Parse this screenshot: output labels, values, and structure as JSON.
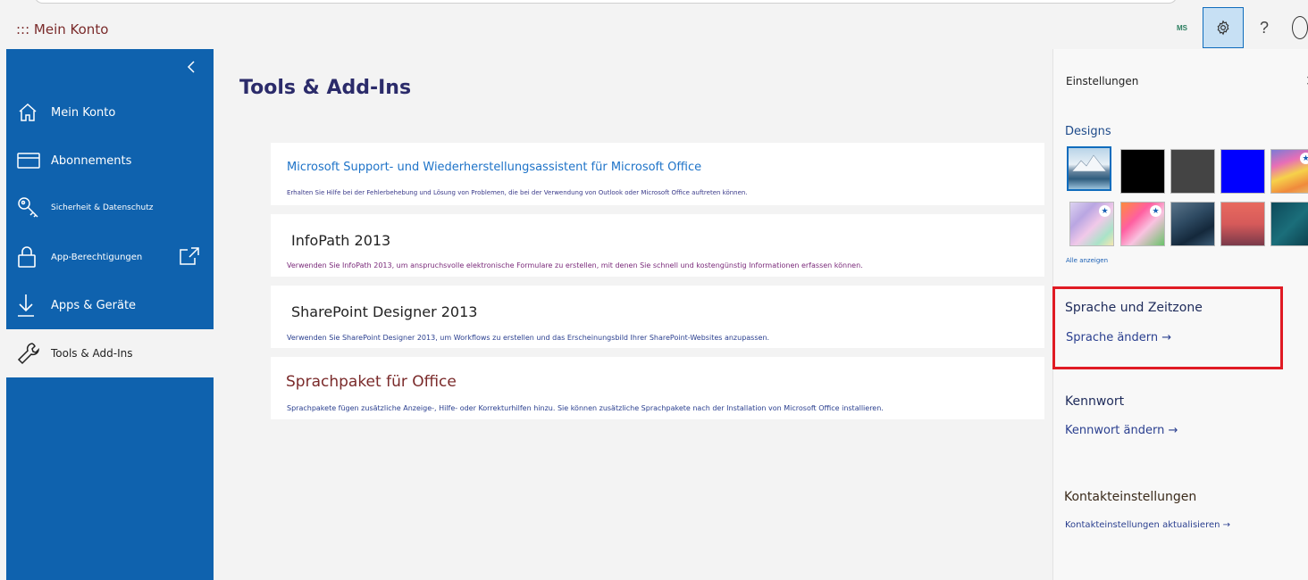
{
  "app": {
    "title": "::: Mein Konto"
  },
  "topbar": {
    "ms_badge": "MS",
    "help": "?"
  },
  "sidebar": {
    "items": [
      {
        "label": "Mein Konto",
        "icon": "home-icon"
      },
      {
        "label": "Abonnements",
        "icon": "card-icon"
      },
      {
        "label": "Sicherheit & Datenschutz",
        "icon": "key-icon"
      },
      {
        "label": "App-Berechtigungen",
        "icon": "lock-icon"
      },
      {
        "label": "Apps & Geräte",
        "icon": "download-icon"
      },
      {
        "label": "Tools & Add-Ins",
        "icon": "wrench-icon"
      }
    ]
  },
  "main": {
    "title": "Tools & Add-Ins",
    "cards": [
      {
        "title": "Microsoft Support- und Wiederherstellungsassistent für Microsoft Office",
        "desc": "Erhalten Sie Hilfe bei der Fehlerbehebung und Lösung von Problemen, die bei der Verwendung von Outlook oder Microsoft Office auftreten können.",
        "title_color": "#1e73c8",
        "desc_color": "#3a3a8a"
      },
      {
        "title": "InfoPath 2013",
        "desc": "Verwenden Sie InfoPath 2013, um anspruchsvolle elektronische Formulare zu erstellen, mit denen Sie schnell und kostengünstig Informationen erfassen können.",
        "title_color": "#222222",
        "desc_color": "#7a2a7a"
      },
      {
        "title": "SharePoint Designer 2013",
        "desc": "Verwenden Sie SharePoint Designer 2013, um Workflows zu erstellen und das Erscheinungsbild Ihrer SharePoint-Websites anzupassen.",
        "title_color": "#222222",
        "desc_color": "#2a3f8f"
      },
      {
        "title": "Sprachpaket für Office",
        "desc": "Sprachpakete fügen zusätzliche Anzeige-, Hilfe- oder Korrekturhilfen hinzu. Sie können zusätzliche Sprachpakete nach der Installation von Microsoft Office installieren.",
        "title_color": "#7a2a2a",
        "desc_color": "#2a3f8f"
      }
    ]
  },
  "settings": {
    "title": "Einstellungen",
    "designs": {
      "heading": "Designs",
      "themes": [
        {
          "name": "mountain-lake",
          "selected": true
        },
        {
          "name": "black"
        },
        {
          "name": "dark-gray"
        },
        {
          "name": "blue"
        },
        {
          "name": "rainbow",
          "premium": true
        },
        {
          "name": "pastel-swirl",
          "premium": true
        },
        {
          "name": "pink-cat",
          "premium": true
        },
        {
          "name": "ocean-waves"
        },
        {
          "name": "palm-sunset"
        },
        {
          "name": "circuit"
        }
      ],
      "show_all": "Alle anzeigen"
    },
    "language": {
      "heading": "Sprache und Zeitzone",
      "link": "Sprache ändern →"
    },
    "password": {
      "heading": "Kennwort",
      "link": "Kennwort ändern →"
    },
    "contact": {
      "heading": "Kontakteinstellungen",
      "link": "Kontakteinstellungen aktualisieren →"
    }
  }
}
